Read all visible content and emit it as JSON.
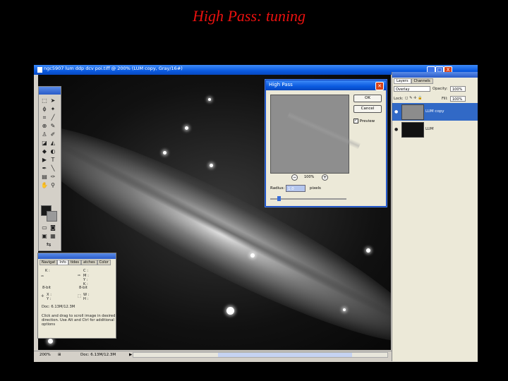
{
  "slide_title": "High Pass: tuning",
  "window": {
    "title": "ngc5907 lum ddp dcv poi.tiff @ 200% (LUM copy, Gray/16#)",
    "buttons": [
      "_",
      "□",
      "X"
    ]
  },
  "statusbar": {
    "zoom": "200%",
    "doc": "Doc: 6.13M/12.3M"
  },
  "info_panel": {
    "tabs": [
      "Navigat",
      "Info",
      "tides",
      "atches",
      "Color"
    ],
    "active_tab": "Info",
    "k_label": "K :",
    "c_label": "C :",
    "m_label": "M :",
    "y_label": "Y :",
    "k2_label": "K :",
    "bit_left": "8-bit",
    "bit_right": "8-bit",
    "x_label": "X :",
    "yy_label": "Y :",
    "w_label": "W :",
    "h_label": "H :",
    "doc": "Doc: 6.13M/12.3M",
    "help": [
      "Click and drag to scroll image in desired",
      "direction.  Use Alt and Ctrl for additional",
      "options"
    ]
  },
  "layers_panel": {
    "tabs": [
      "Layers",
      "Channels"
    ],
    "active_tab": "Layers",
    "blend_mode": "Overlay",
    "opacity_label": "Opacity:",
    "opacity": "100%",
    "lock_label": "Lock:",
    "fill_label": "Fill:",
    "fill": "100%",
    "layers": [
      {
        "name": "LUM copy",
        "selected": true
      },
      {
        "name": "LUM",
        "selected": false
      }
    ]
  },
  "high_pass": {
    "title": "High Pass",
    "ok_label": "OK",
    "cancel_label": "Cancel",
    "preview_label": "Preview",
    "preview_checked": true,
    "zoom": "100%",
    "radius_label": "Radius:",
    "radius_value": "1.0",
    "units": "pixels",
    "slider_fraction": 0.1
  },
  "colors": {
    "title": "#e8110f",
    "selected_layer": "#3169c6",
    "xp_blue": "#0a5ae0"
  }
}
